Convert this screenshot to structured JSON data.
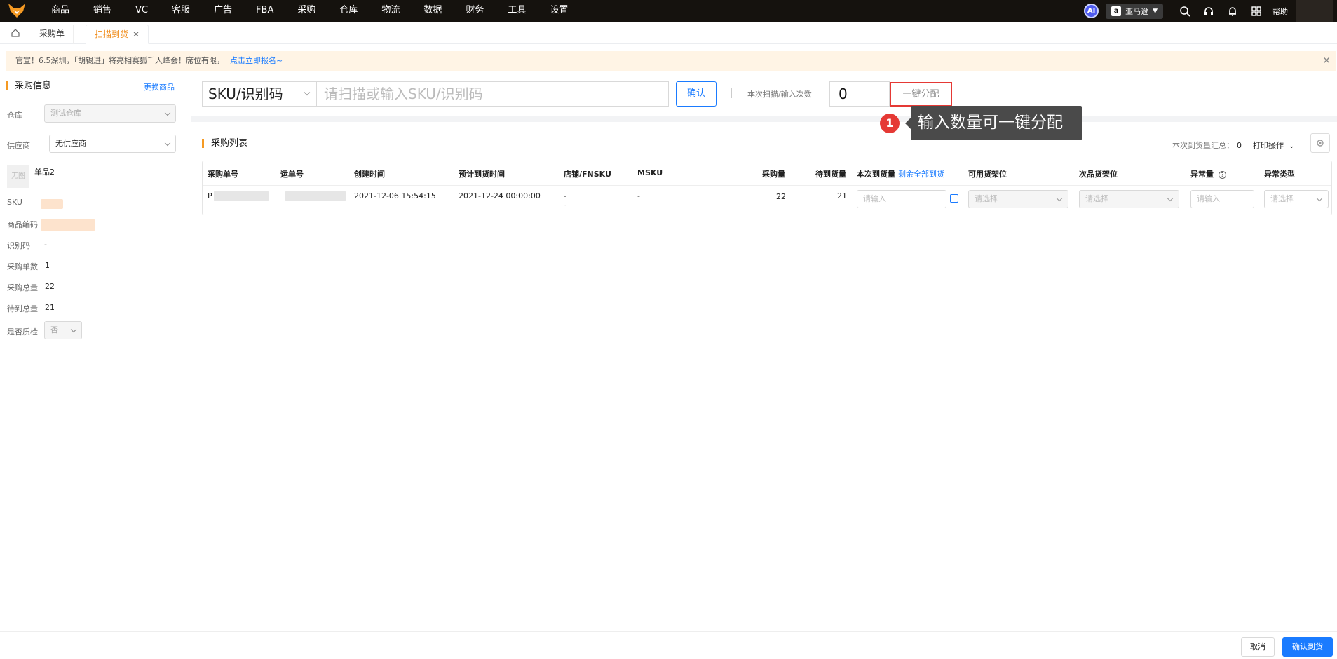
{
  "nav": {
    "items": [
      "商品",
      "销售",
      "VC",
      "客服",
      "广告",
      "FBA",
      "采购",
      "仓库",
      "物流",
      "数据",
      "财务",
      "工具",
      "设置"
    ],
    "ai_label": "AI",
    "store": "亚马逊",
    "help": "帮助"
  },
  "tabs": [
    {
      "label": "采购单"
    },
    {
      "label": "扫描到货",
      "close": "✕"
    }
  ],
  "notice": {
    "text": "官宣！6.5深圳，「胡锡进」将亮相赛狐千人峰会！席位有限，",
    "link": "点击立即报名~",
    "close": "✕"
  },
  "left": {
    "title": "采购信息",
    "change_link": "更换商品",
    "warehouse_label": "仓库",
    "warehouse_value": "测试仓库",
    "supplier_label": "供应商",
    "supplier_value": "无供应商",
    "thumb_text": "无图",
    "product_name": "单品2",
    "sku_label": "SKU",
    "code_label": "商品编码",
    "idcode_label": "识别码",
    "idcode_value": "-",
    "order_count_label": "采购单数",
    "order_count_value": "1",
    "total_label": "采购总量",
    "total_value": "22",
    "pending_label": "待到总量",
    "pending_value": "21",
    "qc_label": "是否质检",
    "qc_value": "否"
  },
  "scan": {
    "type": "SKU/识别码",
    "placeholder": "请扫描或输入SKU/识别码",
    "confirm": "确认",
    "count_label": "本次扫描/输入次数",
    "count_value": "0",
    "allocate": "一键分配"
  },
  "tooltip": {
    "num": "1",
    "text": "输入数量可一键分配"
  },
  "list": {
    "title": "采购列表",
    "summary_label": "本次到货量汇总：",
    "summary_value": "0",
    "print_op": "打印操作",
    "headers": {
      "order_no": "采购单号",
      "tracking": "运单号",
      "created": "创建时间",
      "eta": "预计到货时间",
      "fnsku": "店铺/FNSKU",
      "msku": "MSKU",
      "qty": "采购量",
      "pending": "待到货量",
      "arrival": "本次到货量",
      "arrival_all": "剩余全部到货",
      "shelf": "可用货架位",
      "defect_shelf": "次品货架位",
      "abnormal": "异常量",
      "abnormal_type": "异常类型"
    },
    "rows": [
      {
        "order_no": "P",
        "created": "2021-12-06 15:54:15",
        "eta": "2021-12-24 00:00:00",
        "fnsku": "-",
        "fnsku_sub": "-",
        "msku": "-",
        "qty": "22",
        "pending": "21",
        "arrival_placeholder": "请输入",
        "shelf_placeholder": "请选择",
        "defect_placeholder": "请选择",
        "abnormal_placeholder": "请输入",
        "abnormal_type_placeholder": "请选择"
      }
    ]
  },
  "footer": {
    "cancel": "取消",
    "confirm": "确认到货"
  },
  "colors": {
    "accent": "#1a7bff",
    "active_tab": "#f08c1a",
    "highlight": "#e53935",
    "topbar": "#15120e"
  }
}
